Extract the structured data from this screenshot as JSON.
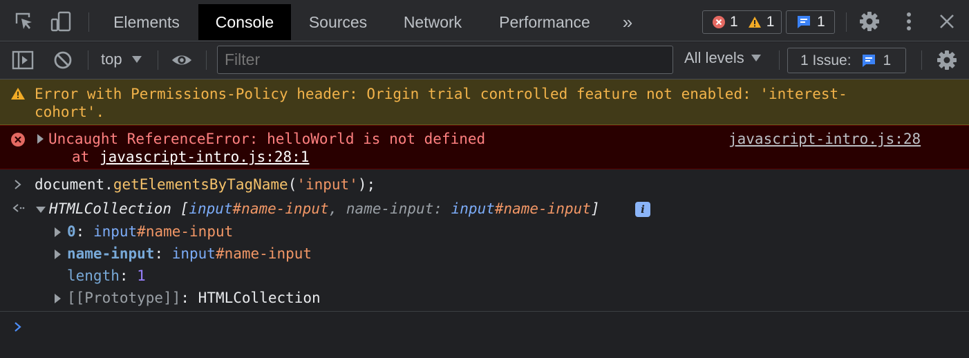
{
  "tabs": [
    {
      "label": "Elements"
    },
    {
      "label": "Console"
    },
    {
      "label": "Sources"
    },
    {
      "label": "Network"
    },
    {
      "label": "Performance"
    }
  ],
  "more_tabs": "»",
  "counts": {
    "errors": "1",
    "warnings": "1",
    "messages": "1"
  },
  "toolbar": {
    "context": "top",
    "filter_placeholder": "Filter",
    "levels": "All levels",
    "issues_label": "1 Issue:",
    "issues_count": "1"
  },
  "warning": {
    "line1": "Error with Permissions-Policy header: Origin trial controlled feature not enabled: 'interest-",
    "line2": "cohort'."
  },
  "error": {
    "message": "Uncaught ReferenceError: helloWorld is not defined",
    "at_prefix": "at ",
    "at_link": "javascript-intro.js:28:1",
    "source": "javascript-intro.js:28"
  },
  "command": {
    "object": "document",
    "dot": ".",
    "method": "getElementsByTagName",
    "open": "(",
    "arg": "'input'",
    "close": ");"
  },
  "result": {
    "type": "HTMLCollection",
    "bracket_open": " [",
    "item1_tag": "input",
    "item1_id": "#name-input",
    "comma": ", ",
    "item2_key": "name-input",
    "item2_colon": ": ",
    "item2_tag": "input",
    "item2_id": "#name-input",
    "bracket_close": "]",
    "info": "i",
    "props": [
      {
        "key": "0",
        "tag": "input",
        "id": "#name-input"
      },
      {
        "key": "name-input",
        "tag": "input",
        "id": "#name-input"
      }
    ],
    "length_key": "length",
    "length_val": "1",
    "proto_key": "[[Prototype]]",
    "proto_val": "HTMLCollection"
  }
}
